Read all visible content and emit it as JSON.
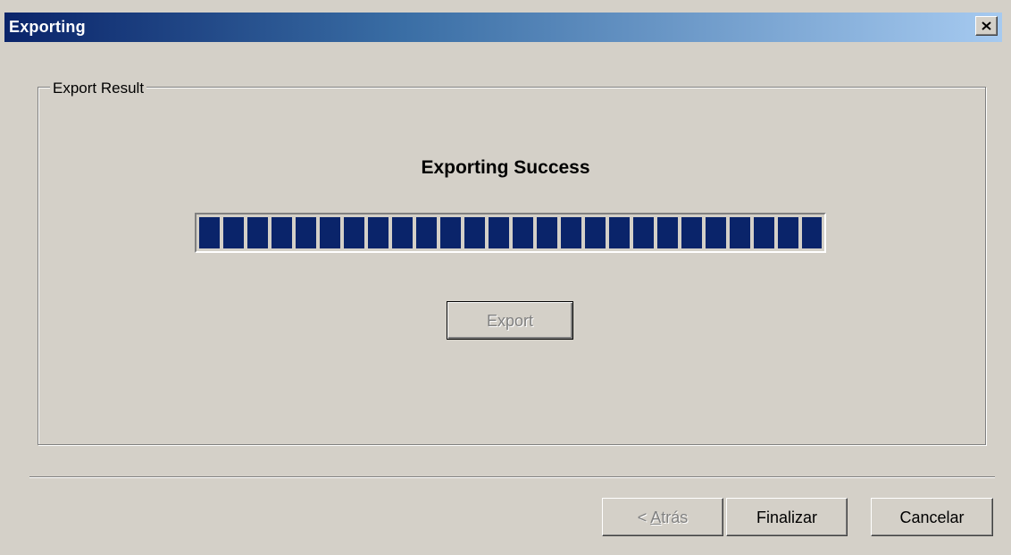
{
  "window": {
    "title": "Exporting"
  },
  "group": {
    "legend": "Export Result"
  },
  "status": {
    "message": "Exporting Success"
  },
  "progress": {
    "fraction": 1.0
  },
  "export_button": {
    "label": "Export",
    "enabled": false
  },
  "footer": {
    "back_prefix": "< ",
    "back_mnemonic": "A",
    "back_rest": "trás",
    "finish_label": "Finalizar",
    "cancel_label": "Cancelar"
  },
  "icons": {
    "close": "close-icon"
  },
  "colors": {
    "title_gradient_start": "#0a246a",
    "title_gradient_end": "#a6caf0",
    "progress_fill": "#0a246a",
    "face": "#d4d0c8"
  }
}
